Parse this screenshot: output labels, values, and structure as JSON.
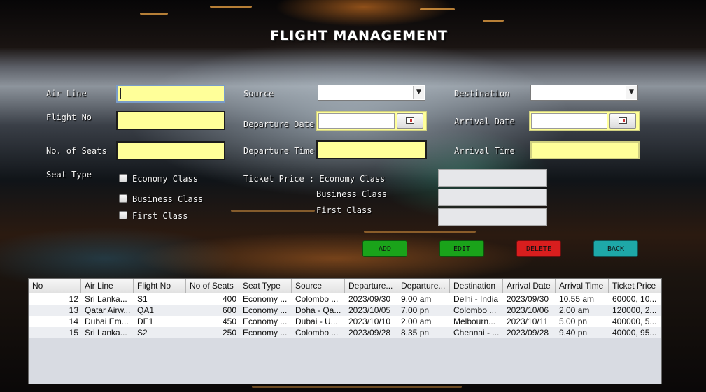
{
  "app": {
    "title": "FLIGHT MANAGEMENT"
  },
  "form": {
    "airline_label": "Air Line",
    "airline_value": "",
    "flight_no_label": "Flight No",
    "flight_no_value": "",
    "seats_label": "No. of Seats",
    "seats_value": "",
    "seat_type_label": "Seat Type",
    "seat_types": [
      {
        "label": "Economy Class",
        "checked": false
      },
      {
        "label": "Business Class",
        "checked": false
      },
      {
        "label": "First Class",
        "checked": false
      }
    ],
    "source_label": "Source",
    "source_value": "",
    "departure_date_label": "Departure Date",
    "departure_date_value": "",
    "departure_time_label": "Departure Time",
    "departure_time_value": "",
    "destination_label": "Destination",
    "destination_value": "",
    "arrival_date_label": "Arrival Date",
    "arrival_date_value": "",
    "arrival_time_label": "Arrival Time",
    "arrival_time_value": "",
    "ticket_price_label": "Ticket Price : Economy Class",
    "business_price_label": "Business Class",
    "first_price_label": "First Class",
    "economy_price_value": "",
    "business_price_value": "",
    "first_price_value": ""
  },
  "actions": {
    "add": "ADD",
    "edit": "EDIT",
    "delete": "DELETE",
    "back": "BACK",
    "colors": {
      "add": "#1aa31a",
      "edit": "#1aa31a",
      "delete": "#d81e1e",
      "back": "#1ea8a8"
    }
  },
  "table": {
    "columns": [
      "No",
      "Air Line",
      "Flight No",
      "No of Seats",
      "Seat Type",
      "Source",
      "Departure...",
      "Departure...",
      "Destination",
      "Arrival Date",
      "Arrival Time",
      "Ticket Price"
    ],
    "rows": [
      [
        "12",
        "Sri Lanka...",
        "S1",
        "400",
        "Economy ...",
        "Colombo ...",
        "2023/09/30",
        "9.00 am",
        "Delhi - India",
        "2023/09/30",
        "10.55 am",
        "60000, 10..."
      ],
      [
        "13",
        "Qatar Airw...",
        "QA1",
        "600",
        "Economy ...",
        "Doha - Qa...",
        "2023/10/05",
        "7.00 pn",
        "Colombo ...",
        "2023/10/06",
        "2.00 am",
        "120000, 2..."
      ],
      [
        "14",
        "Dubai Em...",
        "DE1",
        "450",
        "Economy ...",
        "Dubai - U...",
        "2023/10/10",
        "2.00 am",
        "Melbourn...",
        "2023/10/11",
        "5.00 pn",
        "400000, 5..."
      ],
      [
        "15",
        "Sri Lanka...",
        "S2",
        "250",
        "Economy ...",
        "Colombo ...",
        "2023/09/28",
        "8.35 pn",
        "Chennai - ...",
        "2023/09/28",
        "9.40 pn",
        "40000, 95..."
      ]
    ]
  }
}
